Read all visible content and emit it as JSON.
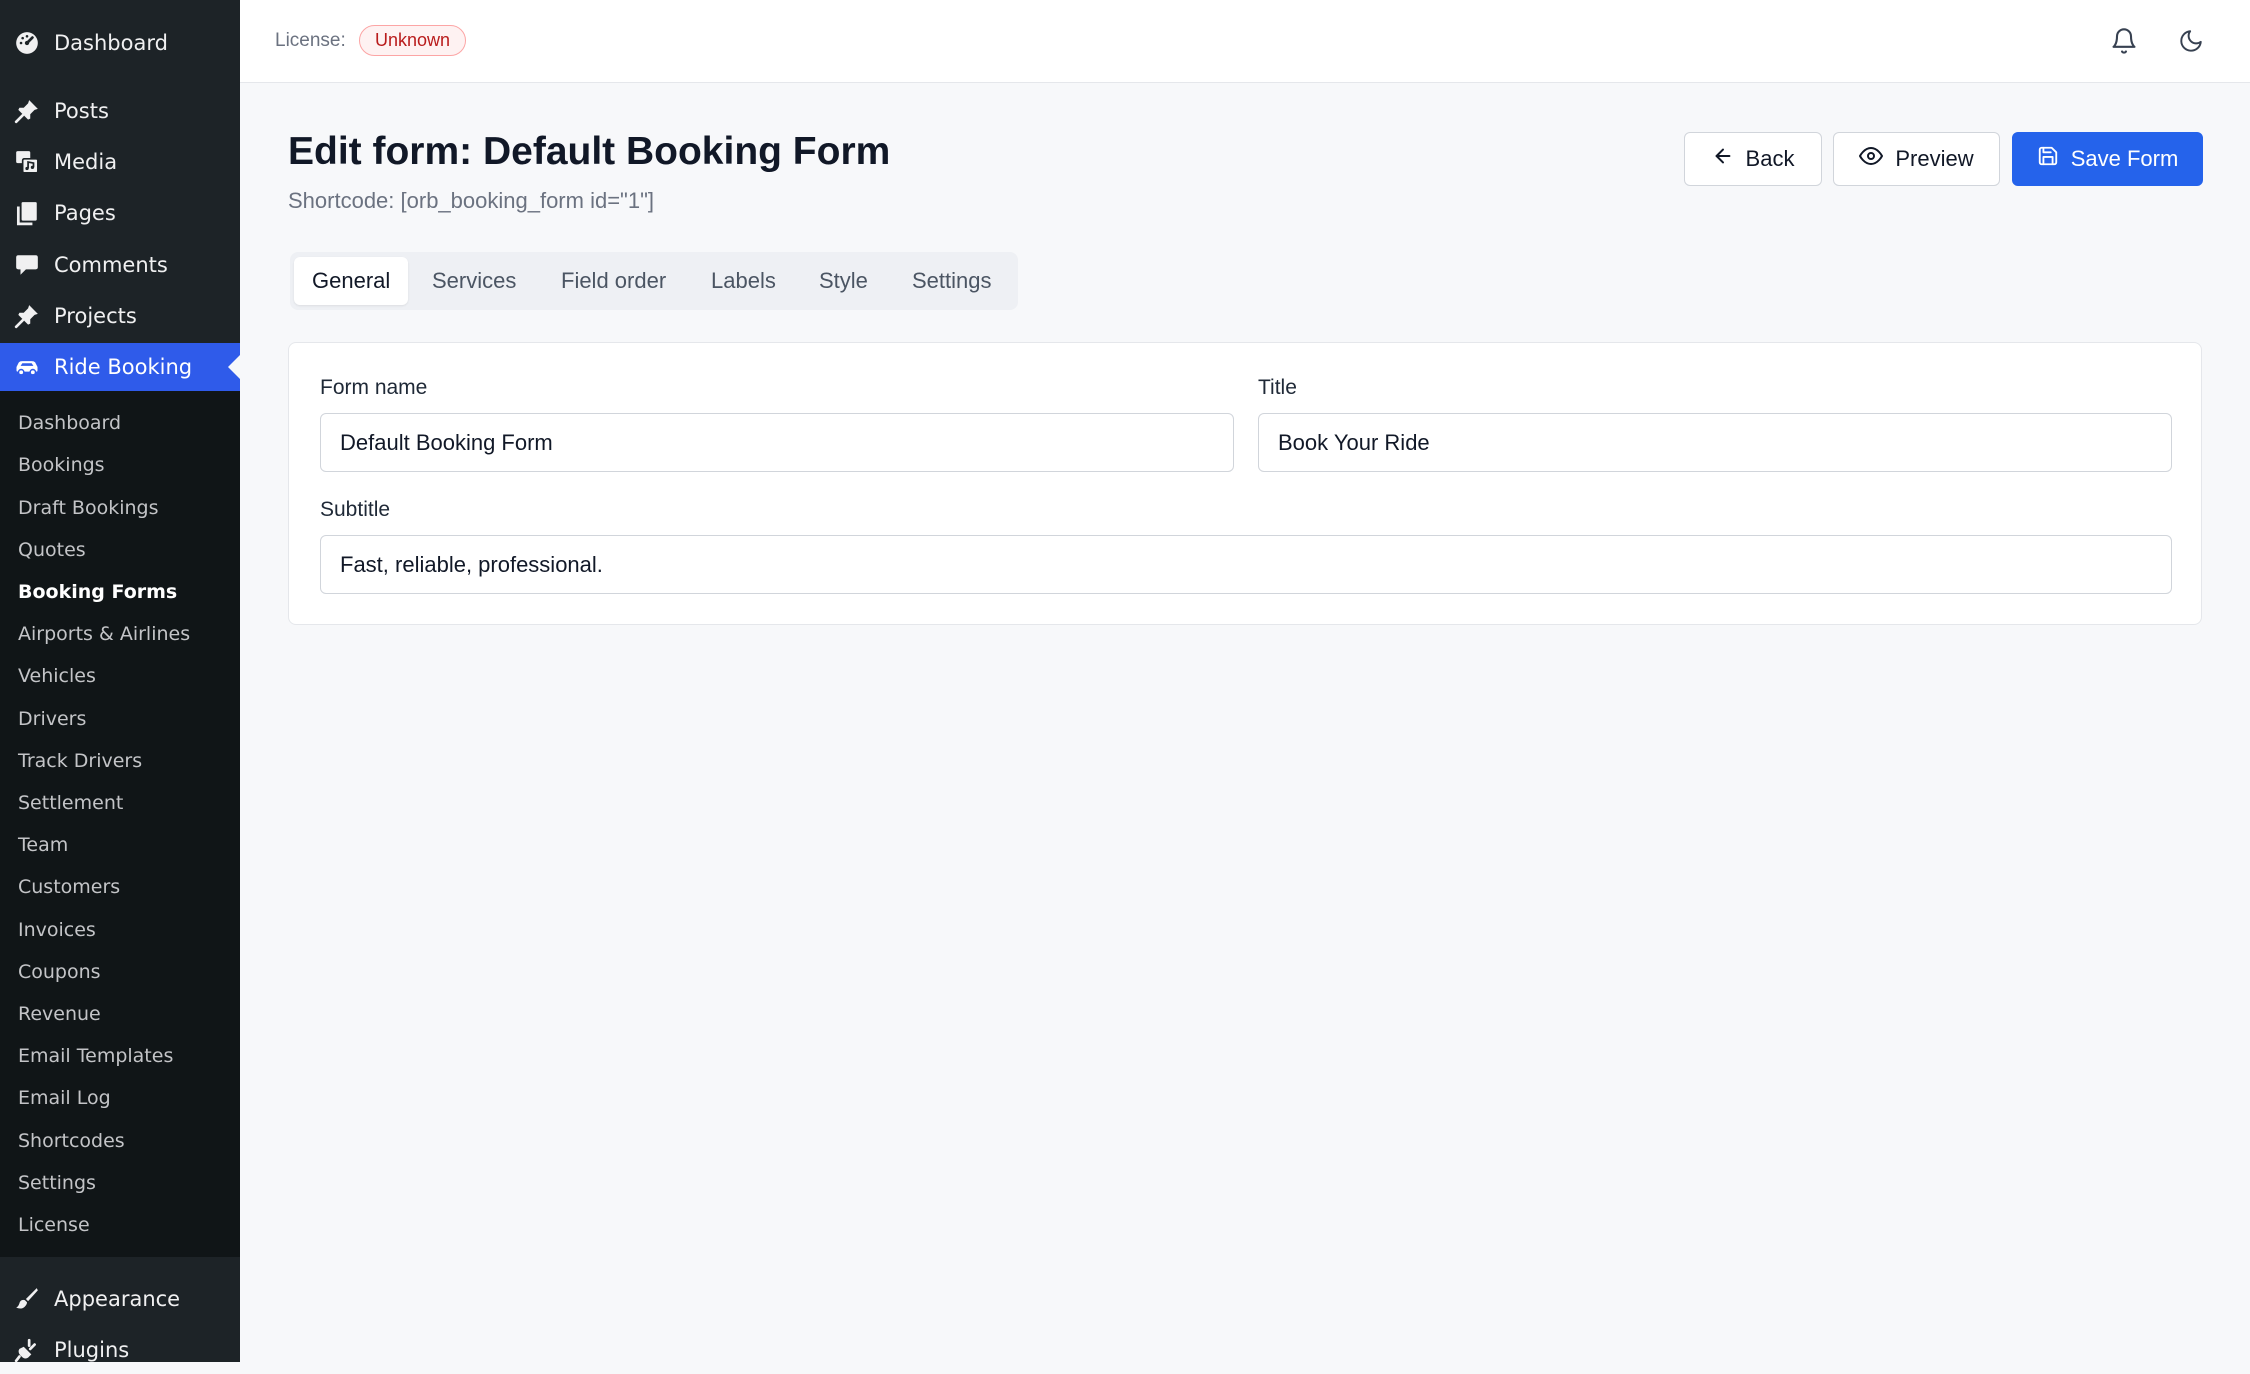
{
  "sidebar": {
    "top_items": [
      {
        "label": "Dashboard",
        "icon": "dashboard-icon"
      },
      {
        "label": "Posts",
        "icon": "pin-icon"
      },
      {
        "label": "Media",
        "icon": "media-icon"
      },
      {
        "label": "Pages",
        "icon": "pages-icon"
      },
      {
        "label": "Comments",
        "icon": "comment-icon"
      },
      {
        "label": "Projects",
        "icon": "pin-icon"
      },
      {
        "label": "Ride Booking",
        "icon": "car-icon",
        "active": true
      }
    ],
    "submenu": [
      "Dashboard",
      "Bookings",
      "Draft Bookings",
      "Quotes",
      "Booking Forms",
      "Airports & Airlines",
      "Vehicles",
      "Drivers",
      "Track Drivers",
      "Settlement",
      "Team",
      "Customers",
      "Invoices",
      "Coupons",
      "Revenue",
      "Email Templates",
      "Email Log",
      "Shortcodes",
      "Settings",
      "License"
    ],
    "submenu_current": "Booking Forms",
    "bottom_items": [
      {
        "label": "Appearance",
        "icon": "brush-icon"
      },
      {
        "label": "Plugins",
        "icon": "plugin-icon"
      }
    ]
  },
  "topbar": {
    "license_label": "License:",
    "license_status": "Unknown",
    "icons": [
      "bell-icon",
      "moon-icon"
    ]
  },
  "header": {
    "title": "Edit form: Default Booking Form",
    "shortcode": "Shortcode: [orb_booking_form id=\"1\"]",
    "back_label": "Back",
    "preview_label": "Preview",
    "save_label": "Save Form"
  },
  "tabs": {
    "items": [
      "General",
      "Services",
      "Field order",
      "Labels",
      "Style",
      "Settings"
    ],
    "active": "General"
  },
  "form": {
    "form_name_label": "Form name",
    "form_name_value": "Default Booking Form",
    "title_label": "Title",
    "title_value": "Book Your Ride",
    "subtitle_label": "Subtitle",
    "subtitle_value": "Fast, reliable, professional."
  },
  "colors": {
    "sidebar_bg": "#1d2327",
    "accent": "#2563eb",
    "active_menu": "#2f5bea",
    "badge_red": "#b91c1c"
  }
}
